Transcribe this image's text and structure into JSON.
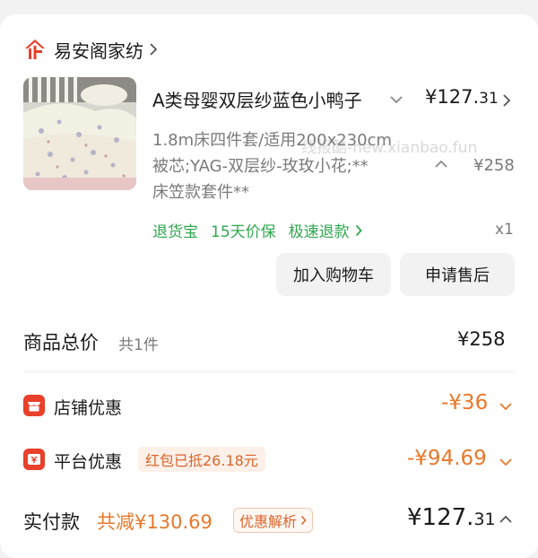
{
  "shop": {
    "name": "易安阁家纺",
    "logo_icon": "enterprise-logo-icon",
    "accent": "#e8402a"
  },
  "product": {
    "title": "A类母婴双层纱蓝色小鸭子",
    "price_int": "¥127.",
    "price_dec": "31",
    "spec_lines": [
      "1.8m床四件套/适用200x230cm",
      "被芯;YAG-双层纱-玫玫小花;**",
      "床笠款套件**"
    ],
    "original_price": "¥258",
    "quantity": "x1",
    "services": [
      "退货宝",
      "15天价保",
      "极速退款"
    ],
    "service_color": "#2fa84f"
  },
  "watermark": "线报酷-new.xianbao.fun",
  "actions": {
    "add_cart": "加入购物车",
    "after_sale": "申请售后"
  },
  "summary": {
    "total_label": "商品总价",
    "total_count": "共1件",
    "total_value": "¥258",
    "store_discount_label": "店铺优惠",
    "store_discount_value": "-¥36",
    "platform_discount_label": "平台优惠",
    "platform_discount_tag": "红包已抵26.18元",
    "platform_discount_value": "-¥94.69",
    "paid_label": "实付款",
    "saved_text": "共减¥130.69",
    "discount_detail_tag": "优惠解析",
    "paid_int": "¥127.",
    "paid_dec": "31",
    "discount_color": "#e8782a"
  }
}
